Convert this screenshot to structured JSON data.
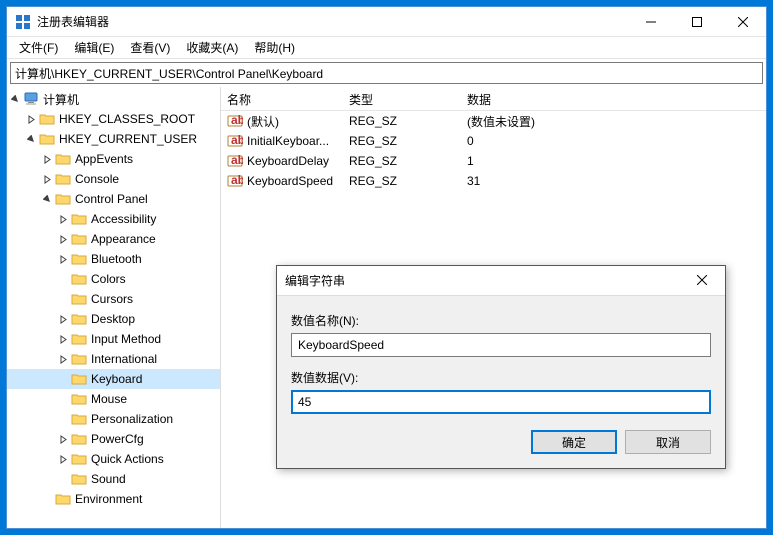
{
  "window": {
    "title": "注册表编辑器"
  },
  "menu": {
    "file": "文件(F)",
    "edit": "编辑(E)",
    "view": "查看(V)",
    "favorites": "收藏夹(A)",
    "help": "帮助(H)"
  },
  "address": "计算机\\HKEY_CURRENT_USER\\Control Panel\\Keyboard",
  "tree": {
    "root": "计算机",
    "hkcr": "HKEY_CLASSES_ROOT",
    "hkcu": "HKEY_CURRENT_USER",
    "appevents": "AppEvents",
    "console": "Console",
    "controlpanel": "Control Panel",
    "cp": {
      "accessibility": "Accessibility",
      "appearance": "Appearance",
      "bluetooth": "Bluetooth",
      "colors": "Colors",
      "cursors": "Cursors",
      "desktop": "Desktop",
      "inputmethod": "Input Method",
      "international": "International",
      "keyboard": "Keyboard",
      "mouse": "Mouse",
      "personalization": "Personalization",
      "powercfg": "PowerCfg",
      "quickactions": "Quick Actions",
      "sound": "Sound"
    },
    "environment": "Environment"
  },
  "list": {
    "headers": {
      "name": "名称",
      "type": "类型",
      "data": "数据"
    },
    "rows": [
      {
        "name": "(默认)",
        "type": "REG_SZ",
        "data": "(数值未设置)"
      },
      {
        "name": "InitialKeyboar...",
        "type": "REG_SZ",
        "data": "0"
      },
      {
        "name": "KeyboardDelay",
        "type": "REG_SZ",
        "data": "1"
      },
      {
        "name": "KeyboardSpeed",
        "type": "REG_SZ",
        "data": "31"
      }
    ]
  },
  "dialog": {
    "title": "编辑字符串",
    "name_label": "数值名称(N):",
    "name_value": "KeyboardSpeed",
    "data_label": "数值数据(V):",
    "data_value": "45",
    "ok": "确定",
    "cancel": "取消"
  }
}
